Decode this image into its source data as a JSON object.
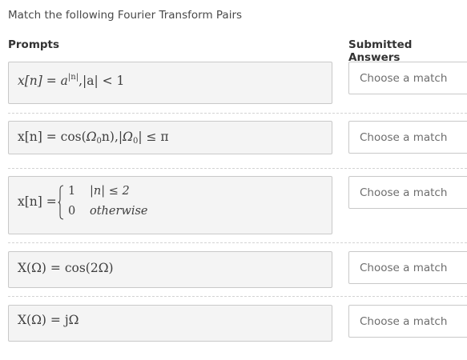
{
  "instruction": "Match the following Fourier Transform Pairs",
  "headers": {
    "prompts": "Prompts",
    "answers": "Submitted Answers"
  },
  "prompts": [
    {
      "math": {
        "lhs": "x[n] = a",
        "exp": "|n|",
        "rest": ",|a| < 1"
      }
    },
    {
      "math": {
        "a": "x[n] = cos(",
        "omega": "Ω",
        "sub": "0",
        "b": "n),|",
        "omega2": "Ω",
        "sub2": "0",
        "c": "| ≤ π"
      }
    },
    {
      "math": {
        "lhs": "x[n] =",
        "row1_val": "1",
        "row1_cond": "|n| ≤ 2",
        "row2_val": "0",
        "row2_cond": "otherwise"
      }
    },
    {
      "math": {
        "text": "X(Ω) = cos(2Ω)"
      }
    },
    {
      "math": {
        "text": "X(Ω) = jΩ"
      }
    }
  ],
  "answers": [
    {
      "placeholder": "Choose a match"
    },
    {
      "placeholder": "Choose a match"
    },
    {
      "placeholder": "Choose a match"
    },
    {
      "placeholder": "Choose a match"
    },
    {
      "placeholder": "Choose a match"
    }
  ]
}
